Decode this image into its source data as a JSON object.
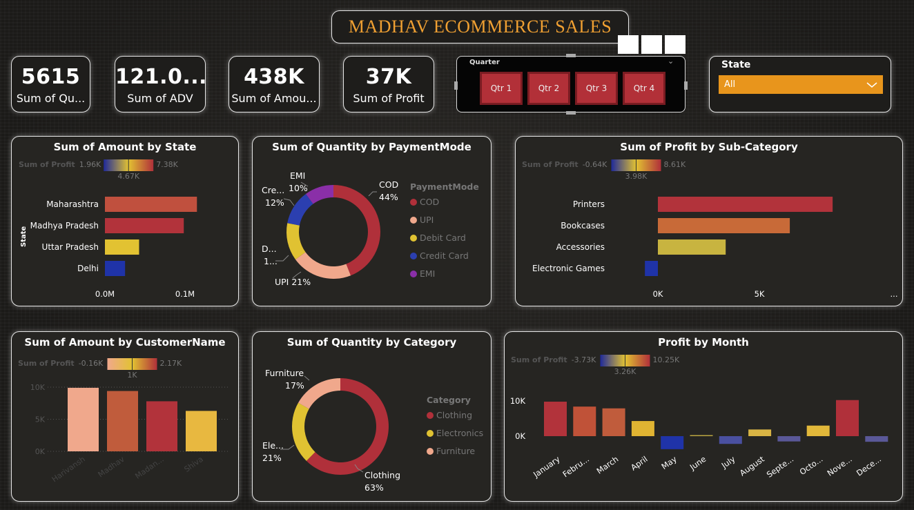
{
  "header": {
    "title": "MADHAV ECOMMERCE  SALES"
  },
  "kpis": [
    {
      "value": "5615",
      "label": "Sum of Qu..."
    },
    {
      "value": "121.0...",
      "label": "Sum of ADV"
    },
    {
      "value": "438K",
      "label": "Sum of Amou..."
    },
    {
      "value": "37K",
      "label": "Sum of Profit"
    }
  ],
  "quarter_slicer": {
    "title": "Quarter",
    "options": [
      "Qtr 1",
      "Qtr 2",
      "Qtr 3",
      "Qtr 4"
    ]
  },
  "state_slicer": {
    "title": "State",
    "selected": "All"
  },
  "colors": {
    "accent_orange": "#f0a032",
    "slicer_orange": "#e8951c",
    "crimson": "#b0303a",
    "salmon": "#f0a88c",
    "yellow": "#e0c232",
    "blue": "#2b3fb0",
    "purple": "#8a2fa8"
  },
  "chart_data": [
    {
      "id": "amount_by_state",
      "type": "bar",
      "orientation": "horizontal",
      "title": "Sum of Amount by State",
      "ylabel": "State",
      "categories": [
        "Maharashtra",
        "Madhya Pradesh",
        "Uttar Pradesh",
        "Delhi"
      ],
      "values": [
        0.105,
        0.09,
        0.039,
        0.023
      ],
      "bar_colors": [
        "#c0503e",
        "#b2333b",
        "#e2c232",
        "#1f33a8"
      ],
      "xlim": [
        0,
        0.13
      ],
      "xticks": [
        "0.0M",
        "0.1M"
      ],
      "gradient_legend": {
        "label": "Sum of Profit",
        "min": "1.96K",
        "mid": "4.67K",
        "max": "7.38K"
      }
    },
    {
      "id": "quantity_by_paymentmode",
      "type": "pie",
      "donut": true,
      "title": "Sum of Quantity by PaymentMode",
      "legend_title": "PaymentMode",
      "labels": [
        "COD",
        "UPI",
        "Debit Card",
        "Credit Card",
        "EMI"
      ],
      "values": [
        44,
        21,
        13,
        12,
        10
      ],
      "colors": [
        "#b0303a",
        "#f0a88c",
        "#e0c232",
        "#2b3fb0",
        "#8a2fa8"
      ],
      "data_labels": [
        {
          "name": "COD",
          "pct": "44%"
        },
        {
          "name": "UPI 21%",
          "pct": ""
        },
        {
          "name": "D...",
          "pct": "1..."
        },
        {
          "name": "Cre...",
          "pct": "12%"
        },
        {
          "name": "EMI",
          "pct": "10%"
        }
      ]
    },
    {
      "id": "profit_by_subcategory",
      "type": "bar",
      "orientation": "horizontal",
      "title": "Sum of Profit by Sub-Category",
      "categories": [
        "Printers",
        "Bookcases",
        "Accessories",
        "Electronic Games"
      ],
      "values": [
        8610,
        6500,
        3340,
        -640
      ],
      "bar_colors": [
        "#b2333b",
        "#c86a38",
        "#c8b440",
        "#1f33a8"
      ],
      "xlim": [
        -1300,
        10000
      ],
      "xticks": [
        {
          "value": 0,
          "label": "0K"
        },
        {
          "value": 5000,
          "label": "5K"
        }
      ],
      "more": "...",
      "gradient_legend": {
        "label": "Sum of Profit",
        "min": "-0.64K",
        "mid": "3.98K",
        "max": "8.61K"
      }
    },
    {
      "id": "amount_by_customername",
      "type": "bar",
      "title": "Sum of Amount by CustomerName",
      "categories": [
        "Harivansh",
        "Madhav",
        "Madan...",
        "Shiva"
      ],
      "values": [
        9900,
        9400,
        7800,
        6300
      ],
      "bar_colors": [
        "#f0a88c",
        "#c05c3c",
        "#b2333b",
        "#e8b840"
      ],
      "ylim": [
        0,
        12000
      ],
      "yticks": [
        {
          "value": 0,
          "label": "0K"
        },
        {
          "value": 5000,
          "label": "5K"
        },
        {
          "value": 10000,
          "label": "10K"
        }
      ],
      "gradient_legend": {
        "label": "Sum of Profit",
        "min": "-0.16K",
        "mid": "1K",
        "max": "2.17K"
      }
    },
    {
      "id": "quantity_by_category",
      "type": "pie",
      "donut": true,
      "title": "Sum of Quantity by Category",
      "legend_title": "Category",
      "labels": [
        "Clothing",
        "Electronics",
        "Furniture"
      ],
      "values": [
        63,
        21,
        17
      ],
      "colors": [
        "#b0303a",
        "#e0c232",
        "#f0a88c"
      ],
      "data_labels": [
        {
          "name": "Clothing",
          "pct": "63%"
        },
        {
          "name": "Ele...",
          "pct": "21%"
        },
        {
          "name": "Furniture",
          "pct": "17%"
        }
      ]
    },
    {
      "id": "profit_by_month",
      "type": "bar",
      "title": "Profit by Month",
      "categories": [
        "January",
        "Febru...",
        "March",
        "April",
        "May",
        "June",
        "July",
        "August",
        "Septe...",
        "Octo...",
        "Nove...",
        "Dece..."
      ],
      "values": [
        9800,
        8400,
        7900,
        4300,
        -3700,
        300,
        -2200,
        1900,
        -1500,
        3000,
        10250,
        -1600
      ],
      "bar_colors": [
        "#b2333b",
        "#c05238",
        "#c05c3c",
        "#e0b432",
        "#1f33a8",
        "#b8a440",
        "#4a50a0",
        "#d8b444",
        "#5a5898",
        "#e2b83a",
        "#b0303a",
        "#5a5898"
      ],
      "ylim": [
        -5000,
        13000
      ],
      "yticks": [
        {
          "value": 0,
          "label": "0K"
        },
        {
          "value": 10000,
          "label": "10K"
        }
      ],
      "gradient_legend": {
        "label": "Sum of Profit",
        "min": "-3.73K",
        "mid": "3.26K",
        "max": "10.25K"
      }
    }
  ]
}
